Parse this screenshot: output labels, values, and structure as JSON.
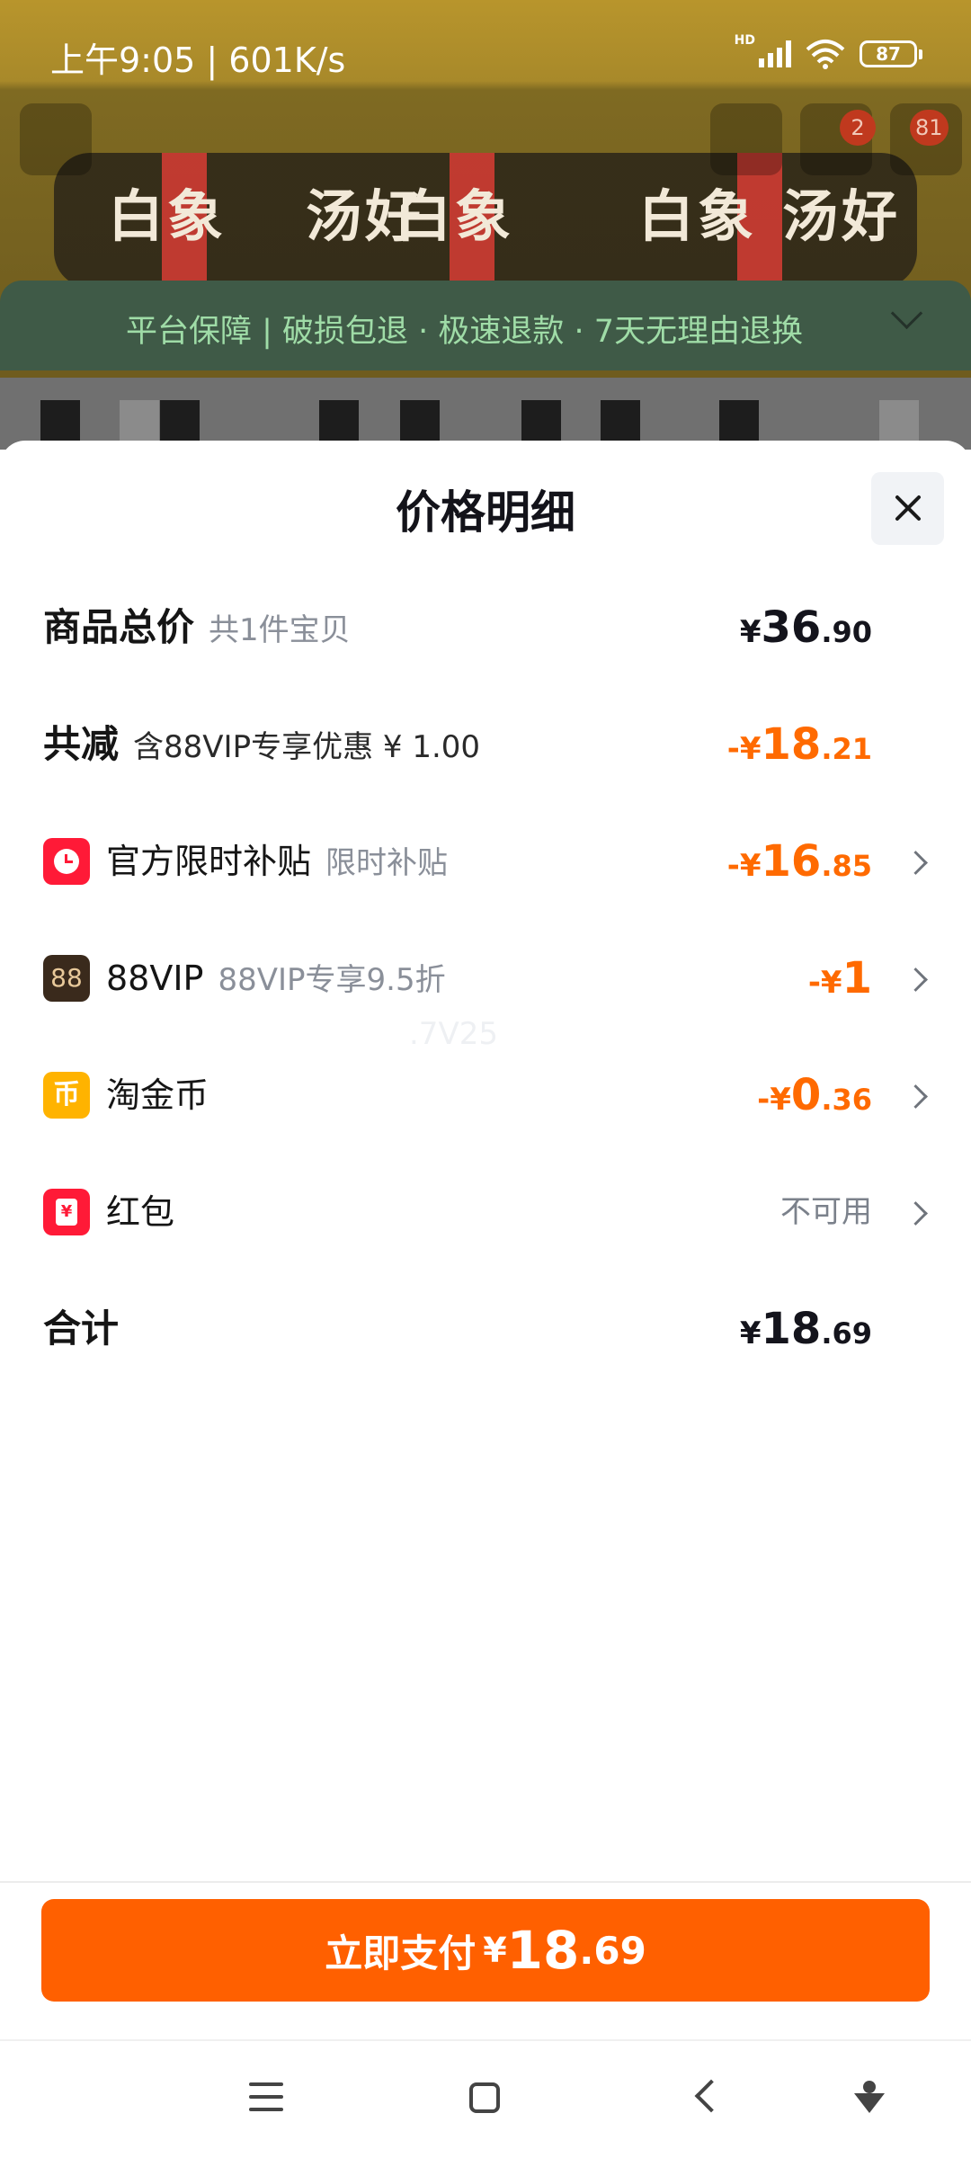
{
  "status_bar": {
    "time": "上午9:05 | 601K/s",
    "hd": "HD",
    "battery": "87"
  },
  "background": {
    "product_text_1": "白象",
    "product_text_2": "汤好",
    "cart_badge": "2",
    "msg_badge": "81",
    "guarantee": "平台保障 | 破损包退 · 极速退款 · 7天无理由退换"
  },
  "sheet": {
    "title": "价格明细"
  },
  "rows": {
    "total": {
      "label": "商品总价",
      "sub": "共1件宝贝",
      "currency": "¥",
      "int": "36",
      "dec": ".90"
    },
    "discount": {
      "label": "共减",
      "sub": "含88VIP专享优惠 ¥ 1.00",
      "prefix": "-¥",
      "int": "18",
      "dec": ".21"
    },
    "subsidy": {
      "label": "官方限时补贴",
      "sub": "限时补贴",
      "prefix": "-¥",
      "int": "16",
      "dec": ".85"
    },
    "vip": {
      "icon_text": "88",
      "label": "88VIP",
      "sub": "88VIP专享9.5折",
      "prefix": "-¥",
      "int": "1"
    },
    "coin": {
      "icon_text": "币",
      "label": "淘金币",
      "prefix": "-¥",
      "int": "0",
      "dec": ".36"
    },
    "redpacket": {
      "icon_text": "¥",
      "label": "红包",
      "value": "不可用"
    },
    "sum": {
      "label": "合计",
      "currency": "¥",
      "int": "18",
      "dec": ".69"
    }
  },
  "watermark": ".7V25",
  "pay_button": {
    "label": "立即支付",
    "currency": "¥",
    "int": "18",
    "dec": ".69"
  },
  "colors": {
    "accent_orange": "#ff6000",
    "discount_orange": "#ff6a00",
    "subsidy_red": "#ff1a37",
    "coin_yellow": "#ffb300"
  },
  "icons": {
    "subsidy": "clock-icon",
    "vip": "vip-88-icon",
    "coin": "coin-icon",
    "redpacket": "red-packet-icon",
    "close": "close-icon",
    "row_arrow": "chevron-right-icon"
  }
}
